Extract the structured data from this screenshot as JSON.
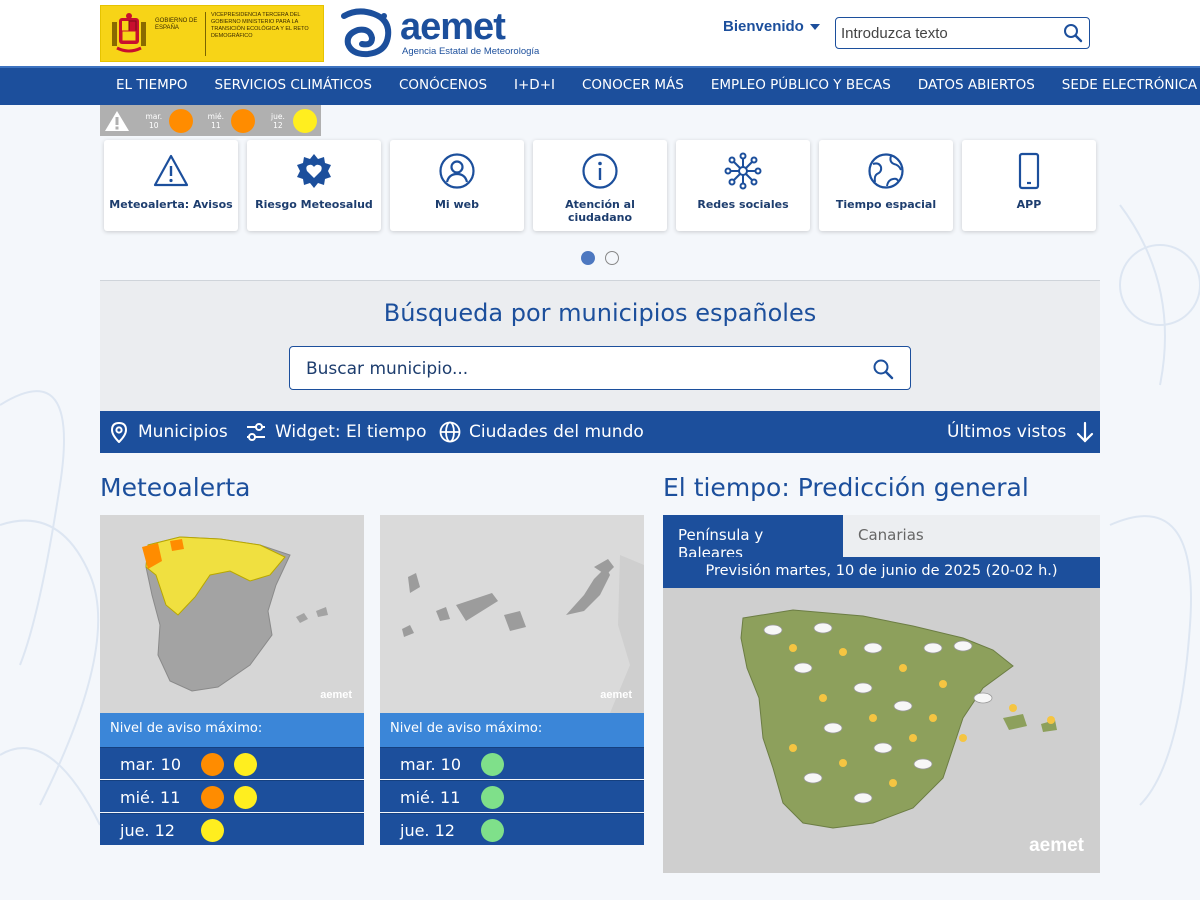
{
  "header": {
    "gov_logo_line1": "GOBIERNO DE ESPAÑA",
    "gov_logo_line2": "VICEPRESIDENCIA TERCERA DEL GOBIERNO MINISTERIO PARA LA TRANSICIÓN ECOLÓGICA Y EL RETO DEMOGRÁFICO",
    "brand": "aemet",
    "brand_subtitle": "Agencia Estatal de Meteorología",
    "welcome": "Bienvenido",
    "search_placeholder": "Introduzca texto"
  },
  "nav": [
    "EL TIEMPO",
    "SERVICIOS CLIMÁTICOS",
    "CONÓCENOS",
    "I+D+I",
    "CONOCER MÁS",
    "EMPLEO PÚBLICO Y BECAS",
    "DATOS ABIERTOS",
    "SEDE ELECTRÓNICA"
  ],
  "alert_strip": [
    {
      "day": "mar.",
      "num": "10",
      "color": "#ff8c00"
    },
    {
      "day": "mié.",
      "num": "11",
      "color": "#ff8c00"
    },
    {
      "day": "jue.",
      "num": "12",
      "color": "#ffee1f"
    }
  ],
  "quick_links": [
    {
      "label": "Meteoalerta: Avisos",
      "icon": "warning-triangle-icon"
    },
    {
      "label": "Riesgo Meteosalud",
      "icon": "heart-badge-icon"
    },
    {
      "label": "Mi web",
      "icon": "user-circle-icon"
    },
    {
      "label": "Atención al ciudadano",
      "icon": "info-circle-icon"
    },
    {
      "label": "Redes sociales",
      "icon": "network-icon"
    },
    {
      "label": "Tiempo espacial",
      "icon": "globe-icon"
    },
    {
      "label": "APP",
      "icon": "smartphone-icon"
    }
  ],
  "municipios": {
    "title": "Búsqueda por municipios españoles",
    "placeholder": "Buscar municipio..."
  },
  "tools": {
    "municipios": "Municipios",
    "widget": "Widget: El tiempo",
    "ciudades": "Ciudades del mundo",
    "ultimos": "Últimos vistos"
  },
  "meteoalerta": {
    "title": "Meteoalerta",
    "watermark": "aemet",
    "level_heading": "Nivel de aviso máximo:",
    "peninsula": [
      {
        "day": "mar. 10",
        "colors": [
          "#ff8c00",
          "#ffee1f"
        ]
      },
      {
        "day": "mié. 11",
        "colors": [
          "#ff8c00",
          "#ffee1f"
        ]
      },
      {
        "day": "jue. 12",
        "colors": [
          "#ffee1f"
        ]
      }
    ],
    "canarias": [
      {
        "day": "mar. 10",
        "colors": [
          "#7fe08a"
        ]
      },
      {
        "day": "mié. 11",
        "colors": [
          "#7fe08a"
        ]
      },
      {
        "day": "jue. 12",
        "colors": [
          "#7fe08a"
        ]
      }
    ]
  },
  "prediccion": {
    "title": "El tiempo: Predicción general",
    "tab_active": "Península y Baleares",
    "tab_inactive": "Canarias",
    "subtitle": "Previsión martes, 10 de junio de 2025 (20-02 h.)",
    "watermark": "aemet"
  },
  "colors": {
    "primary": "#1c4f9c",
    "accent": "#3b86d8",
    "orange": "#ff8c00",
    "yellow": "#ffee1f",
    "green": "#7fe08a"
  }
}
